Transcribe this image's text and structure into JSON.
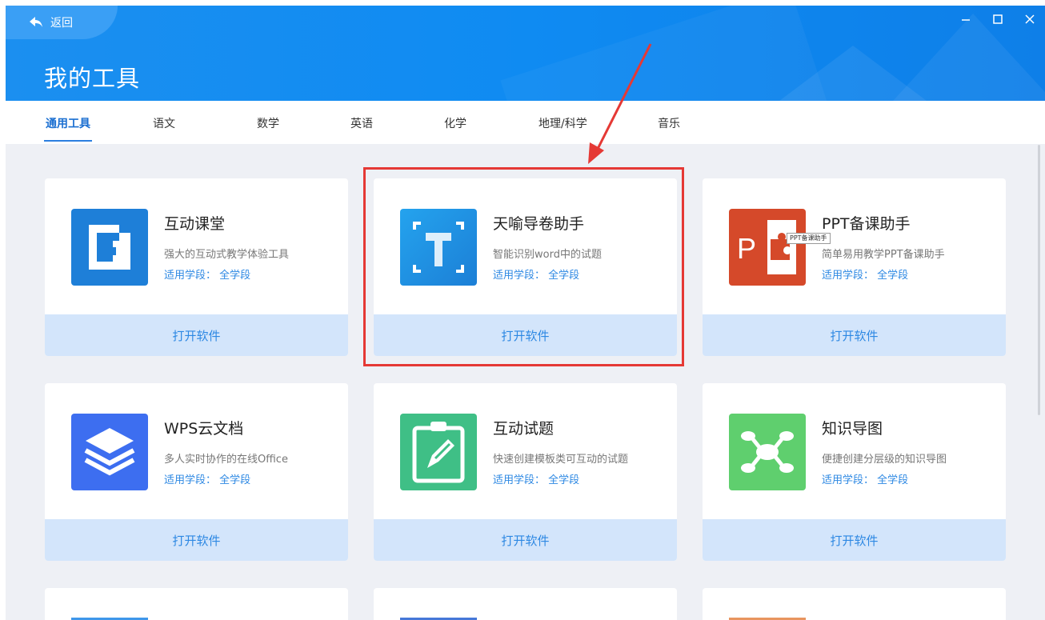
{
  "header": {
    "back_label": "返回",
    "title": "我的工具"
  },
  "window_controls": [
    "minimize-icon",
    "maximize-icon",
    "close-icon"
  ],
  "tabs": [
    {
      "label": "通用工具",
      "active": true
    },
    {
      "label": "语文"
    },
    {
      "label": "数学"
    },
    {
      "label": "英语"
    },
    {
      "label": "化学"
    },
    {
      "label": "地理/科学"
    },
    {
      "label": "音乐"
    }
  ],
  "tools": [
    {
      "name": "互动课堂",
      "desc": "强大的互动式教学体验工具",
      "level": "适用学段： 全学段",
      "open": "打开软件",
      "icon": "interactive-class-icon",
      "color": "#1e7fd8"
    },
    {
      "name": "天喻导卷助手",
      "desc": "智能识别word中的试题",
      "level": "适用学段： 全学段",
      "open": "打开软件",
      "icon": "paper-import-icon",
      "color": "#1e8fe0"
    },
    {
      "name": "PPT备课助手",
      "desc": "简单易用教学PPT备课助手",
      "level": "适用学段： 全学段",
      "open": "打开软件",
      "icon": "ppt-icon",
      "color": "#d5492a"
    },
    {
      "name": "WPS云文档",
      "desc": "多人实时协作的在线Office",
      "level": "适用学段： 全学段",
      "open": "打开软件",
      "icon": "wps-cloud-icon",
      "color": "#3d6ef0"
    },
    {
      "name": "互动试题",
      "desc": "快速创建模板类可互动的试题",
      "level": "适用学段： 全学段",
      "open": "打开软件",
      "icon": "interactive-question-icon",
      "color": "#3fbf86"
    },
    {
      "name": "知识导图",
      "desc": "便捷创建分层级的知识导图",
      "level": "适用学段： 全学段",
      "open": "打开软件",
      "icon": "mind-map-icon",
      "color": "#5fcf6e"
    }
  ],
  "tooltip": "PPT备课助手",
  "colors": {
    "header": "#0f8bf2",
    "accent": "#2d88e3",
    "open_bg": "#d3e5fb",
    "highlight": "#e53935",
    "content_bg": "#eef0f5"
  }
}
